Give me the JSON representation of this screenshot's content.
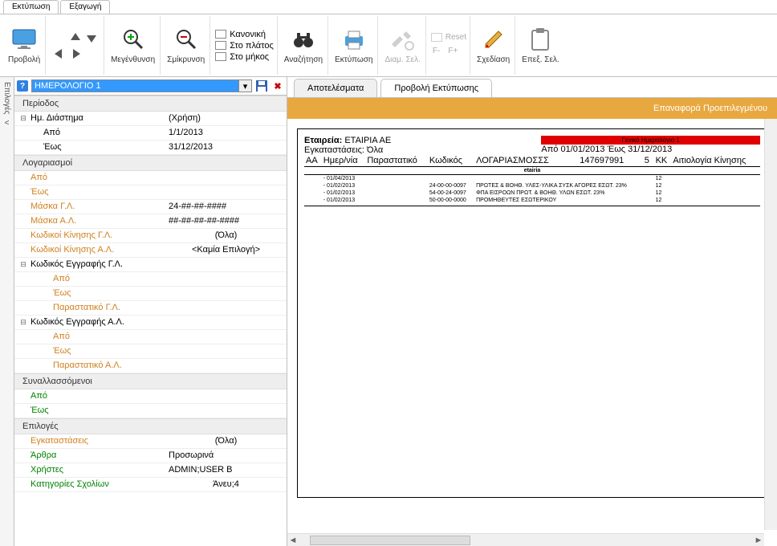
{
  "top_tabs": {
    "print": "Εκτύπωση",
    "export": "Εξαγωγή"
  },
  "toolbar": {
    "preview": "Προβολή",
    "zoom_in": "Μεγένθυνση",
    "zoom_out": "Σμίκρυνση",
    "normal": "Κανονική",
    "fit_width": "Στο πλάτος",
    "fit_length": "Στο μήκος",
    "search": "Αναζήτηση",
    "print": "Εκτύπωση",
    "page_setup": "Διαμ. Σελ.",
    "reset": "Reset",
    "f_minus": "F-",
    "f_plus": "F+",
    "design": "Σχεδίαση",
    "edit_page": "Επεξ. Σελ."
  },
  "sidebar_tab": "Επιλογές",
  "report_name": "ΗΜΕΡΟΛΟΓΙΟ 1",
  "sections": {
    "period": "Περίοδος",
    "accounts": "Λογαριασμοί",
    "gl_code": "Κωδικός Εγγραφής Γ.Λ.",
    "al_code": "Κωδικός Εγγραφής Α.Λ.",
    "parties": "Συναλλασσόμενοι",
    "options": "Επιλογές"
  },
  "rows": {
    "date_range": {
      "label": "Ημ. Διάστημα",
      "value": "(Χρήση)"
    },
    "from": {
      "label": "Από",
      "value": "1/1/2013"
    },
    "to": {
      "label": "Έως",
      "value": "31/12/2013"
    },
    "acc_from": "Από",
    "acc_to": "Έως",
    "mask_gl": {
      "label": "Μάσκα Γ.Λ.",
      "value": "24-##-##-####"
    },
    "mask_al": {
      "label": "Μάσκα Α.Λ.",
      "value": "##-##-##-##-####"
    },
    "move_codes_gl": {
      "label": "Κωδικοί Κίνησης Γ.Λ.",
      "value": "(Όλα)"
    },
    "move_codes_al": {
      "label": "Κωδικοί Κίνησης Α.Λ.",
      "value": "<Καμία Επιλογή>"
    },
    "sub_from": "Από",
    "sub_to": "Έως",
    "doc_gl": "Παραστατικό Γ.Λ.",
    "doc_al": "Παραστατικό Α.Λ.",
    "party_from": "Από",
    "party_to": "Έως",
    "facilities": {
      "label": "Εγκαταστάσεις",
      "value": "(Όλα)"
    },
    "articles": {
      "label": "Άρθρα",
      "value": "Προσωρινά"
    },
    "users": {
      "label": "Χρήστες",
      "value": "ADMIN;USER B"
    },
    "comment_cats": {
      "label": "Κατηγορίες Σχολίων",
      "value": "Άνευ;4"
    }
  },
  "right_tabs": {
    "results": "Αποτελέσματα",
    "print_preview": "Προβολή Εκτύπωσης"
  },
  "reset_default": "Επαναφορά Προεπιλεγμένου",
  "report": {
    "company_label": "Εταιρεία:",
    "company": "ΕΤΑΙΡΙΑ ΑΕ",
    "facilities_label": "Εγκαταστάσεις:",
    "facilities": "Όλα",
    "title": "Γενικό Ημερολόγιο 1",
    "range": "Από 01/01/2013 Έως 31/12/2013",
    "code_h": "147697991",
    "code_h2": "5",
    "headers": [
      "ΑΑ",
      "Ημερ/νία",
      "Παραστατικό",
      "Κωδικός",
      "ΛΟΓΑΡΙΑΣΜΟΣΣΣ",
      "",
      "",
      "ΚΚ",
      "Αιτιολογία Κίνησης"
    ],
    "subtitle": "etairia",
    "rows": [
      {
        "date": "- 01/04/2013",
        "code": "",
        "acc": "",
        "kk": "12"
      },
      {
        "date": "- 01/02/2013",
        "code": "24-00-00-0097",
        "acc": "ΠΡΩΤΕΣ & ΒΟΗΘ. ΥΛΕΣ-ΥΛΙΚΑ ΣΥΣΚ ΑΓΟΡΕΣ ΕΣΩΤ. 23%",
        "kk": "12"
      },
      {
        "date": "- 01/02/2013",
        "code": "54-00-24-0097",
        "acc": "ΦΠΑ ΕΙΣΡΟΩΝ ΠΡΩΤ. & ΒΟΗΘ. ΥΛΩΝ ΕΣΩΤ. 23%",
        "kk": "12"
      },
      {
        "date": "- 01/02/2013",
        "code": "50-00-00-0000",
        "acc": "ΠΡΟΜΗΘΕΥΤΕΣ ΕΣΩΤΕΡΙΚΟΥ",
        "kk": "12"
      }
    ]
  }
}
